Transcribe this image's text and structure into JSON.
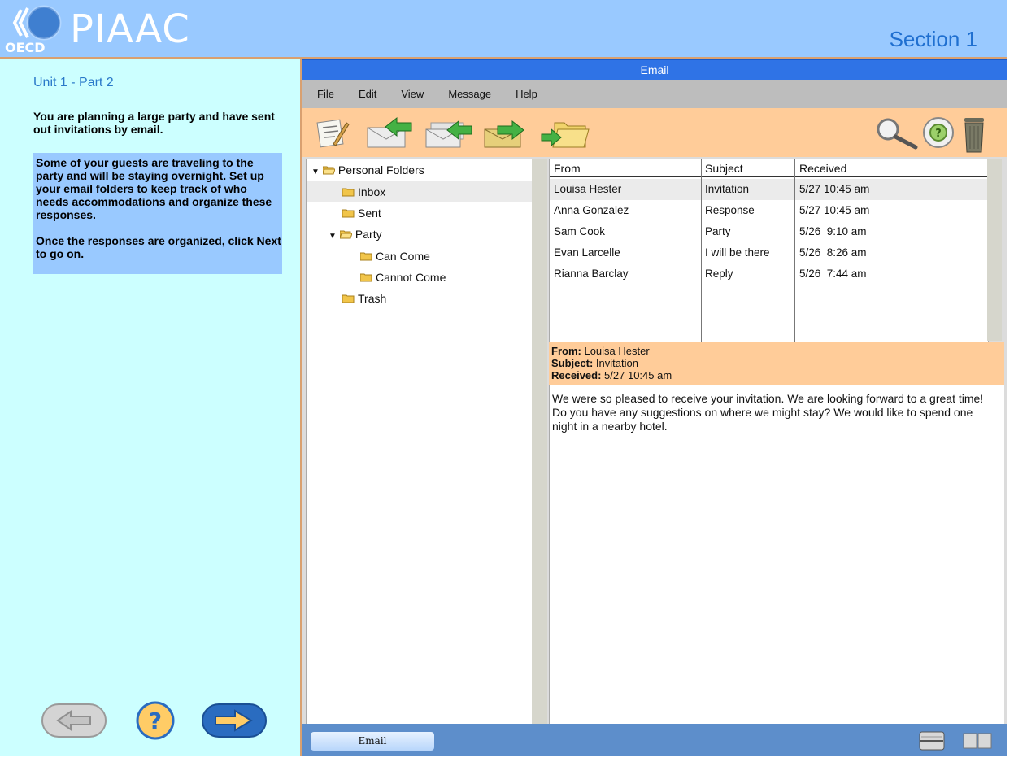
{
  "header": {
    "brand_small": "OECD",
    "brand": "PIAAC",
    "section": "Section 1"
  },
  "left": {
    "unit_title": "Unit 1 - Part 2",
    "intro": "You are planning a large party and have sent out invitations by email.",
    "instruction_1": "Some of your guests are traveling to the party and will be staying overnight. Set up your email folders to keep track of who needs accommodations and organize these responses.",
    "instruction_2": "Once the responses are organized, click Next to go on."
  },
  "email": {
    "title": "Email",
    "menu": [
      "File",
      "Edit",
      "View",
      "Message",
      "Help"
    ],
    "folders": {
      "root": "Personal Folders",
      "inbox": "Inbox",
      "sent": "Sent",
      "party": "Party",
      "can_come": "Can Come",
      "cannot_come": "Cannot Come",
      "trash": "Trash"
    },
    "columns": {
      "from": "From",
      "subject": "Subject",
      "received": "Received"
    },
    "messages": [
      {
        "from": "Louisa Hester",
        "subject": "Invitation",
        "received": "5/27 10:45 am"
      },
      {
        "from": "Anna Gonzalez",
        "subject": "Response",
        "received": "5/27 10:45 am"
      },
      {
        "from": "Sam Cook",
        "subject": "Party",
        "received": "5/26  9:10 am"
      },
      {
        "from": "Evan Larcelle",
        "subject": "I will be there",
        "received": "5/26  8:26 am"
      },
      {
        "from": "Rianna Barclay",
        "subject": "Reply",
        "received": "5/26  7:44 am"
      }
    ],
    "preview": {
      "from_label": "From:",
      "from": "Louisa Hester",
      "subject_label": "Subject:",
      "subject": "Invitation",
      "received_label": "Received:",
      "received": "5/27 10:45 am",
      "body": "We were so pleased to receive your invitation.  We are looking forward to a great time!  Do you have any suggestions on where we might stay?  We would like to spend one night in a nearby hotel."
    },
    "status_tab": "Email"
  },
  "colors": {
    "header_bg": "#99c9ff",
    "left_bg": "#ccffff",
    "toolbar_bg": "#ffcc99",
    "title_bar": "#2f73e6",
    "accent_line": "#d9a070"
  }
}
